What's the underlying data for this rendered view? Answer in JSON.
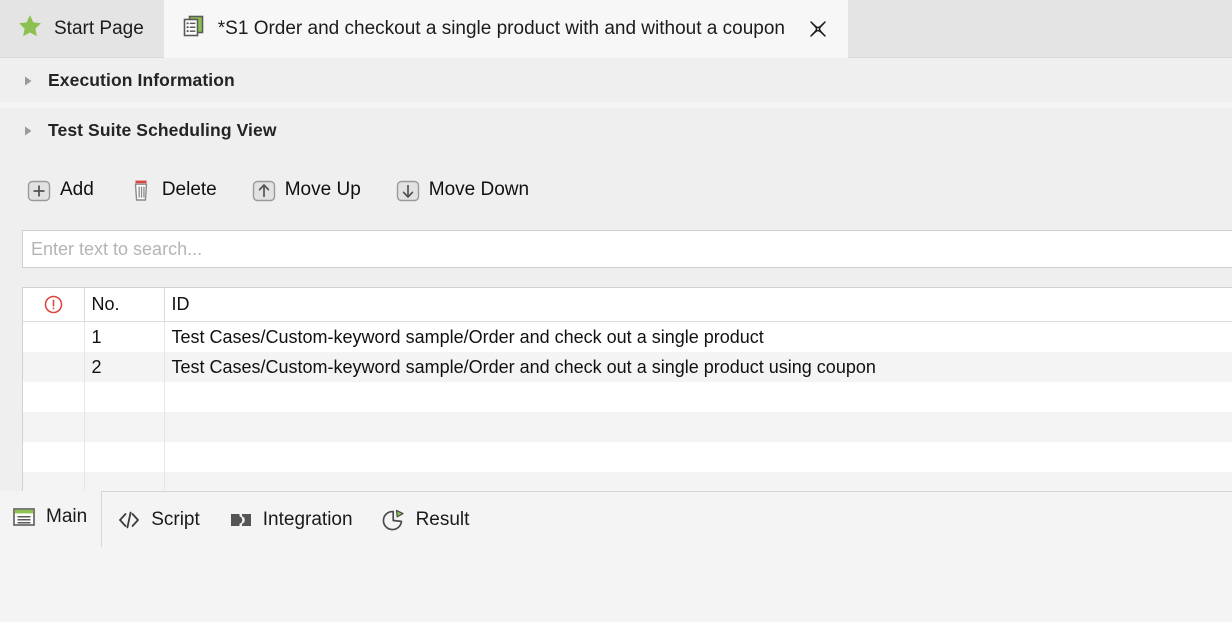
{
  "window": {
    "top_tabs": [
      {
        "icon": "star-icon",
        "label": "Start Page",
        "active": false,
        "closable": false
      },
      {
        "icon": "test-suite-icon",
        "label": "*S1 Order and checkout a single product with and without a coupon",
        "active": true,
        "closable": true
      }
    ],
    "close_icon": "close-icon"
  },
  "sections": [
    {
      "title": "Execution Information",
      "expanded": false,
      "arrow": "chevron-right-icon"
    },
    {
      "title": "Test Suite Scheduling View",
      "expanded": false,
      "arrow": "chevron-right-icon"
    }
  ],
  "toolbar": {
    "buttons": [
      {
        "label": "Add",
        "icon": "plus-box-icon"
      },
      {
        "label": "Delete",
        "icon": "trash-icon"
      },
      {
        "label": "Move Up",
        "icon": "arrow-up-box-icon"
      },
      {
        "label": "Move Down",
        "icon": "arrow-down-box-icon"
      }
    ]
  },
  "search": {
    "placeholder": "Enter text to search...",
    "value": ""
  },
  "table": {
    "columns": [
      {
        "key": "flag",
        "label": "",
        "icon": "error-circle-icon"
      },
      {
        "key": "no",
        "label": "No."
      },
      {
        "key": "id",
        "label": "ID"
      }
    ],
    "rows": [
      {
        "no": "1",
        "id": "Test Cases/Custom-keyword sample/Order and check out a single product"
      },
      {
        "no": "2",
        "id": "Test Cases/Custom-keyword sample/Order and check out a single product using coupon"
      }
    ],
    "empty_row_count": 5
  },
  "bottom_tabs": [
    {
      "label": "Main",
      "icon": "main-window-icon",
      "active": true
    },
    {
      "label": "Script",
      "icon": "code-icon",
      "active": false
    },
    {
      "label": "Integration",
      "icon": "integration-plug-icon",
      "active": false
    },
    {
      "label": "Result",
      "icon": "pie-chart-icon",
      "active": false
    }
  ],
  "colors": {
    "accent_green": "#8cc152",
    "error_red": "#d9453b",
    "tab_active_bg": "#f7f7f7",
    "tab_inactive_bg": "#e4e4e4",
    "panel_bg": "#efefef",
    "row_alt_bg": "#f4f4f4"
  }
}
